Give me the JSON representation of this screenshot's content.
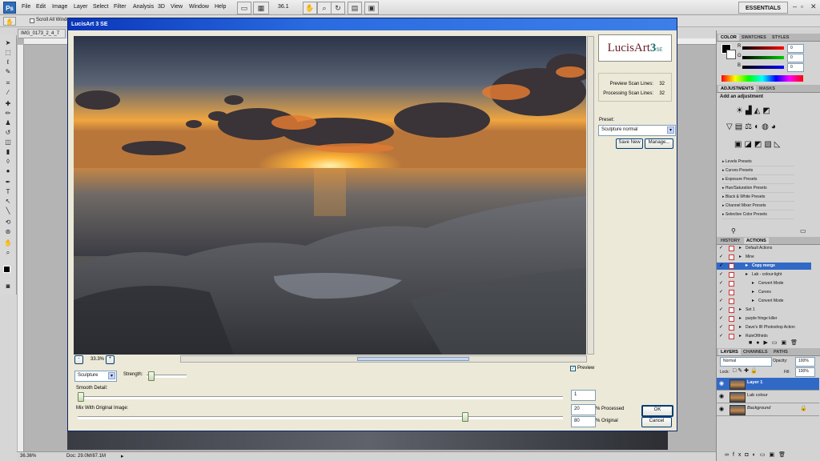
{
  "app": {
    "menus": [
      "File",
      "Edit",
      "Image",
      "Layer",
      "Select",
      "Filter",
      "Analysis",
      "3D",
      "View",
      "Window",
      "Help"
    ],
    "zoom_dropdown": "36.1",
    "workspace": "ESSENTIALS",
    "doc_tab": "IMG_0173_2_4_7",
    "options": {
      "scroll_all_label": "Scroll All Windo"
    },
    "status": {
      "zoom": "36.36%",
      "doc": "Doc: 29.0M/87.1M"
    }
  },
  "dialog": {
    "title": "LucisArt 3 SE",
    "logo_text": "LucisArt",
    "logo_num": "3",
    "logo_se": "SE",
    "preview_scan_label": "Preview Scan Lines:",
    "preview_scan_value": "32",
    "processing_scan_label": "Processing Scan Lines:",
    "processing_scan_value": "32",
    "preset_label": "Preset:",
    "preset_value": "Sculpture normal",
    "save_new": "Save New",
    "manage": "Manage...",
    "zoom_minus": "-",
    "zoom_value": "33.3%",
    "zoom_plus": "+",
    "preview_checkbox_label": "Preview",
    "preview_checked": true,
    "mode_value": "Sculpture",
    "strength_label": "Strength:",
    "strength_level": 0.05,
    "smooth_label": "Smooth Detail:",
    "smooth_value": "1",
    "smooth_level": 0.0,
    "mix_label": "Mix With Original Image:",
    "processed_value": "20",
    "processed_label": "% Processed",
    "original_value": "80",
    "original_label": "% Original",
    "mix_level": 0.8,
    "ok": "OK",
    "cancel": "Cancel"
  },
  "color_panel": {
    "tabs": [
      "COLOR",
      "SWATCHES",
      "STYLES"
    ],
    "r_label": "R",
    "r_value": "0",
    "g_label": "G",
    "g_value": "0",
    "b_label": "B",
    "b_value": "0"
  },
  "adjustments_panel": {
    "tabs": [
      "ADJUSTMENTS",
      "MASKS"
    ],
    "heading": "Add an adjustment",
    "presets": [
      "Levels Presets",
      "Curves Presets",
      "Exposure Presets",
      "Hue/Saturation Presets",
      "Black & White Presets",
      "Channel Mixer Presets",
      "Selective Color Presets"
    ]
  },
  "actions_panel": {
    "tabs": [
      "HISTORY",
      "ACTIONS"
    ],
    "rows": [
      {
        "label": "Default Actions",
        "indent": 0,
        "highlight": false
      },
      {
        "label": "Mine",
        "indent": 0,
        "highlight": false
      },
      {
        "label": "Copy merge",
        "indent": 1,
        "highlight": true
      },
      {
        "label": "Lab - colour-light",
        "indent": 1,
        "highlight": false
      },
      {
        "label": "Convert Mode",
        "indent": 2,
        "highlight": false
      },
      {
        "label": "Curves",
        "indent": 2,
        "highlight": false
      },
      {
        "label": "Convert Mode",
        "indent": 2,
        "highlight": false
      },
      {
        "label": "Set 1",
        "indent": 0,
        "highlight": false
      },
      {
        "label": "purple fringe killer",
        "indent": 0,
        "highlight": false
      },
      {
        "label": "Dave's IR Photoshop Action",
        "indent": 0,
        "highlight": false
      },
      {
        "label": "RuleOfthirds",
        "indent": 0,
        "highlight": false
      }
    ]
  },
  "layers_panel": {
    "tabs": [
      "LAYERS",
      "CHANNELS",
      "PATHS"
    ],
    "blend_mode": "Normal",
    "opacity_label": "Opacity:",
    "opacity_value": "100%",
    "lock_label": "Lock:",
    "fill_label": "Fill:",
    "fill_value": "100%",
    "layers": [
      {
        "name": "Layer 1",
        "selected": true,
        "locked": false
      },
      {
        "name": "Lab colour",
        "selected": false,
        "locked": false
      },
      {
        "name": "Background",
        "selected": false,
        "locked": true
      }
    ]
  },
  "colors": {
    "title_blue": "#0a36b8",
    "selection_blue": "#3169c6"
  }
}
